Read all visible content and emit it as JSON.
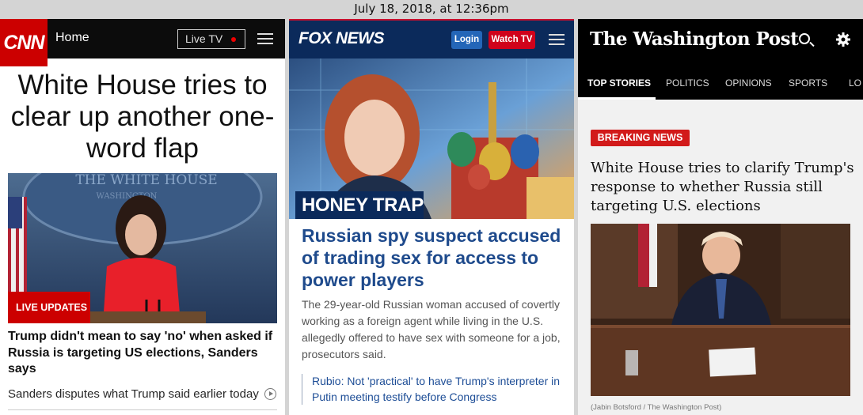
{
  "timestamp": "July 18, 2018, at 12:36pm",
  "cnn": {
    "logo": "CNN",
    "nav_home": "Home",
    "live_tv": "Live TV",
    "headline": "White House tries to clear up another one-word flap",
    "badge": "LIVE UPDATES",
    "subheadline": "Trump didn't mean to say 'no' when asked if Russia is targeting US elections, Sanders says",
    "related_link": "Sanders disputes what Trump said earlier today",
    "photo_sign": "THE WHITE HOUSE",
    "photo_sign_2": "WASHINGTON",
    "icons": [
      "menu-icon",
      "live-dot-icon",
      "play-icon"
    ],
    "brand_color": "#cc0000"
  },
  "fox": {
    "logo": "FOX NEWS",
    "login": "Login",
    "watch_tv": "Watch TV",
    "kicker": "HONEY TRAP",
    "headline": "Russian spy suspect accused of trading sex for access to power players",
    "body": "The 29-year-old Russian woman accused of covertly working as a foreign agent while living in the U.S. allegedly offered to have sex with someone for a job, prosecutors said.",
    "related_link": "Rubio: Not 'practical' to have Trump's interpreter in Putin meeting testify before Congress",
    "icons": [
      "menu-icon"
    ],
    "brand_color": "#0b2a5b",
    "accent_color": "#d0021b"
  },
  "wapo": {
    "logo": "The Washington Post",
    "nav": [
      "TOP STORIES",
      "POLITICS",
      "OPINIONS",
      "SPORTS",
      "LO"
    ],
    "badge": "BREAKING NEWS",
    "headline": "White House tries to clarify Trump's response to whether Russia still targeting U.S. elections",
    "caption": "(Jabin Botsford / The Washington Post)",
    "icons": [
      "search-icon",
      "gear-icon"
    ],
    "accent_color": "#d21a1a"
  }
}
